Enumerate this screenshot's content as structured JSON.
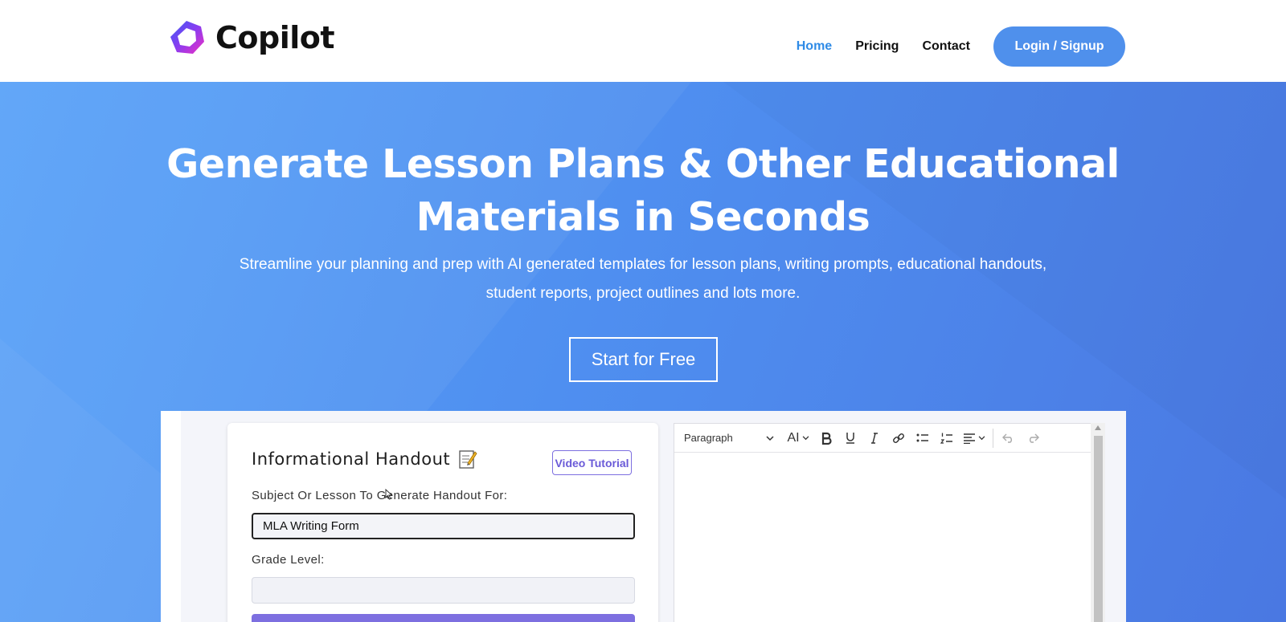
{
  "brand": {
    "name": "Copilot"
  },
  "nav": {
    "items": [
      {
        "label": "Home",
        "active": true
      },
      {
        "label": "Pricing",
        "active": false
      },
      {
        "label": "Contact",
        "active": false
      }
    ],
    "login_label": "Login / Signup"
  },
  "hero": {
    "title_line1": "Generate Lesson Plans & Other Educational",
    "title_line2": "Materials in Seconds",
    "subtitle_line1": "Streamline your planning and prep with AI generated templates for lesson plans, writing prompts, educational handouts,",
    "subtitle_line2": "student reports, project outlines and lots more.",
    "cta_label": "Start for Free"
  },
  "preview": {
    "form": {
      "title": "Informational Handout",
      "title_icon": "memo-icon",
      "video_button": "Video Tutorial",
      "subject_label": "Subject Or Lesson To Generate Handout For:",
      "subject_value": "MLA Writing Form",
      "grade_label": "Grade Level:",
      "grade_value": ""
    },
    "editor": {
      "block_format": "Paragraph",
      "font_size_icon": "AI",
      "tools": [
        "bold-icon",
        "underline-icon",
        "italic-icon",
        "link-icon",
        "bullet-list-icon",
        "numbered-list-icon",
        "align-icon",
        "undo-icon",
        "redo-icon"
      ]
    }
  },
  "colors": {
    "accent": "#2f8be6",
    "login_button": "#4f90ec",
    "hero_gradient_start": "#5aa3f8",
    "hero_gradient_end": "#4a78e2",
    "form_accent": "#7d6fe0"
  }
}
